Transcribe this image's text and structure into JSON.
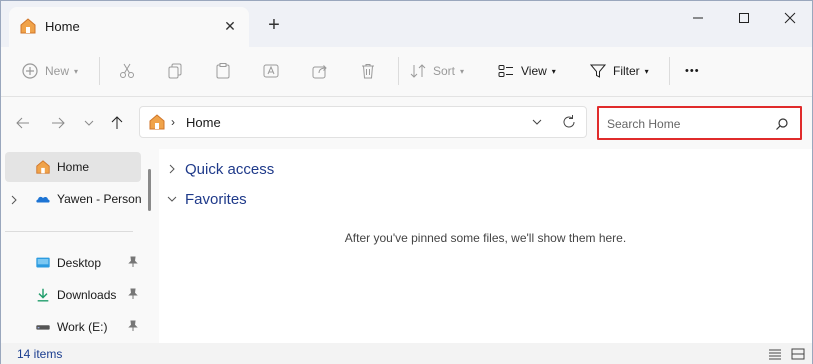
{
  "tab": {
    "title": "Home",
    "close_label": "✕",
    "new_tab_label": "+"
  },
  "toolbar": {
    "new_label": "New",
    "sort_label": "Sort",
    "view_label": "View",
    "filter_label": "Filter",
    "more_label": "•••"
  },
  "address": {
    "separator": "›",
    "location": "Home"
  },
  "search": {
    "placeholder": "Search Home",
    "highlight_color": "#e02b2b"
  },
  "sidebar": {
    "items": [
      {
        "label": "Home",
        "icon": "home-icon",
        "selected": true
      },
      {
        "label": "Yawen - Personal",
        "icon": "onedrive-cloud-icon",
        "expandable": true
      },
      {
        "label": "Desktop",
        "icon": "desktop-folder-icon",
        "pinned": true
      },
      {
        "label": "Downloads",
        "icon": "download-icon",
        "pinned": true
      },
      {
        "label": "Work (E:)",
        "icon": "drive-icon",
        "pinned": true
      }
    ]
  },
  "main": {
    "groups": [
      {
        "label": "Quick access",
        "expanded": false
      },
      {
        "label": "Favorites",
        "expanded": true
      }
    ],
    "empty_message": "After you've pinned some files, we'll show them here."
  },
  "status": {
    "count": "14 items"
  },
  "colors": {
    "accent_text": "#1f3a8a",
    "selected_bg": "#e4e4e4"
  }
}
